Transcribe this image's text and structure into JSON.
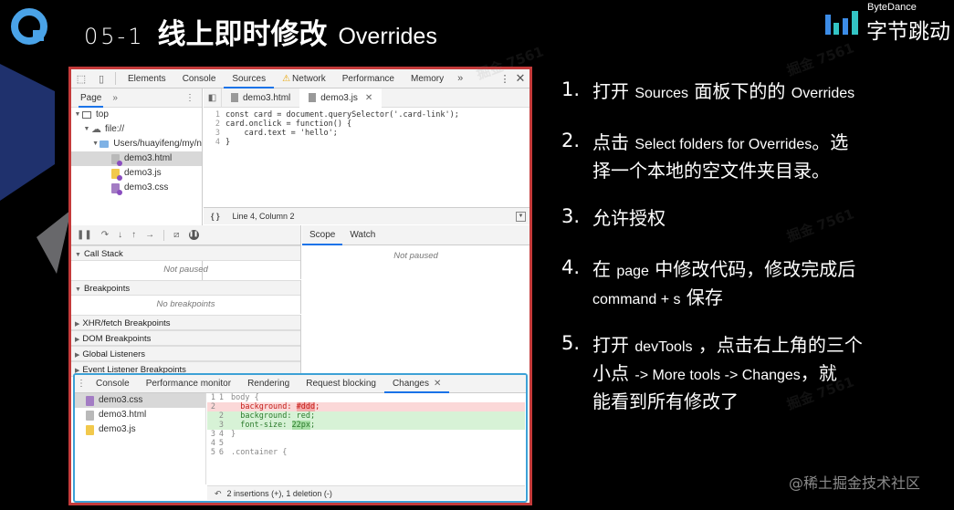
{
  "header": {
    "number": "05-1",
    "title_cn": "线上即时修改",
    "title_en": "Overrides"
  },
  "brand": {
    "top": "ByteDance",
    "name": "字节跳动"
  },
  "colors": {
    "accent_blue": "#1a73e8",
    "panel_border": "#c43a3a",
    "drawer_border": "#3da1d6",
    "logo_blue": "#4aa3e8"
  },
  "devtools": {
    "tabs": [
      "Elements",
      "Console",
      "Sources",
      "Network",
      "Performance",
      "Memory"
    ],
    "more": "»",
    "close": "✕",
    "navigator": {
      "tab": "Page",
      "more": "»",
      "tree": [
        {
          "label": "top"
        },
        {
          "label": "file://"
        },
        {
          "label": "Users/huayifeng/my/n"
        },
        {
          "label": "demo3.html"
        },
        {
          "label": "demo3.js"
        },
        {
          "label": "demo3.css"
        }
      ]
    },
    "editor": {
      "tabs": [
        "demo3.html",
        "demo3.js"
      ],
      "lines": [
        {
          "n": "1",
          "text": "const card = document.querySelector('.card-link');"
        },
        {
          "n": "2",
          "text": "card.onclick = function() {"
        },
        {
          "n": "3",
          "text": "    card.text = 'hello';"
        },
        {
          "n": "4",
          "text": "}"
        }
      ],
      "status": "Line 4, Column 2",
      "brace": "{ }"
    },
    "scope": {
      "tabs": [
        "Scope",
        "Watch"
      ],
      "message": "Not paused"
    },
    "sections": [
      {
        "label": "Call Stack",
        "body": "Not paused"
      },
      {
        "label": "Breakpoints",
        "body": "No breakpoints"
      },
      {
        "label": "XHR/fetch Breakpoints"
      },
      {
        "label": "DOM Breakpoints"
      },
      {
        "label": "Global Listeners"
      },
      {
        "label": "Event Listener Breakpoints"
      }
    ],
    "drawer": {
      "tabs": [
        "Console",
        "Performance monitor",
        "Rendering",
        "Request blocking",
        "Changes"
      ],
      "files": [
        "demo3.css",
        "demo3.html",
        "demo3.js"
      ],
      "diff": [
        {
          "n1": "1",
          "n2": "1",
          "text": "body {"
        },
        {
          "n1": "2",
          "n2": "",
          "pre": "  background: ",
          "hl": "#ddd",
          "post": ";"
        },
        {
          "n1": "",
          "n2": "2",
          "text": "  background: red;"
        },
        {
          "n1": "",
          "n2": "3",
          "pre": "  font-size: ",
          "hl": "22px",
          "post": ";"
        },
        {
          "n1": "3",
          "n2": "4",
          "text": "}"
        },
        {
          "n1": "4",
          "n2": "5",
          "text": ""
        },
        {
          "n1": "5",
          "n2": "6",
          "text": ".container {"
        }
      ],
      "footer": "2 insertions (+), 1 deletion (-)"
    }
  },
  "steps": [
    {
      "index": "1.",
      "line1_a": "打开 ",
      "line1_b": "Sources",
      "line1_c": " 面板下的的 ",
      "line1_d": "Overrides"
    },
    {
      "index": "2.",
      "line1_a": "点击 ",
      "line1_b": "Select folders for Overrides",
      "line1_c": "。选",
      "line2": "择一个本地的空文件夹目录。"
    },
    {
      "index": "3.",
      "line1_a": "允许授权"
    },
    {
      "index": "4.",
      "line1_a": "在 ",
      "line1_b": "page",
      "line1_c": " 中修改代码，修改完成后",
      "line2_a": "command + s",
      "line2_b": " 保存"
    },
    {
      "index": "5.",
      "line1_a": "打开 ",
      "line1_b": "devTools",
      "line1_c": " ，点击右上角的三个",
      "line2_a": "小点 ",
      "line2_b": "-> More tools -> Changes",
      "line2_c": "，就",
      "line3": "能看到所有修改了"
    }
  ],
  "watermark": "@稀土掘金技术社区"
}
